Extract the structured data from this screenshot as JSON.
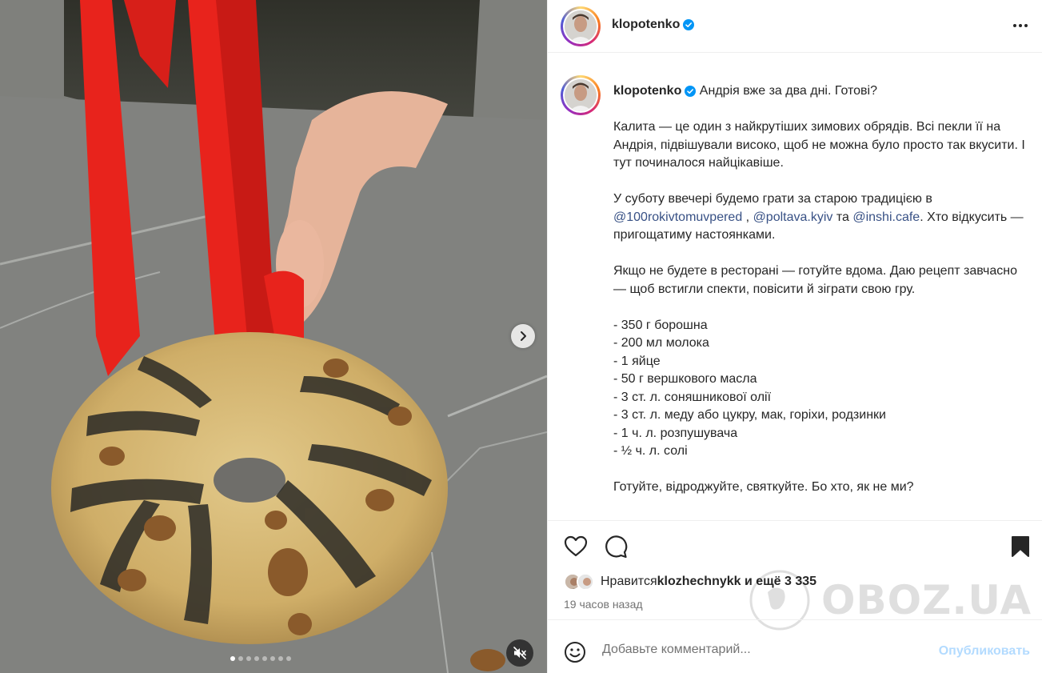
{
  "post": {
    "author": "klopotenko",
    "verified": true
  },
  "header": {
    "username": "klopotenko",
    "more_icon": "more-horizontal-icon"
  },
  "caption": {
    "username": "klopotenko",
    "first_line": " Андрія вже за два дні. Готові?",
    "para1": "Калита — це один з найкрутіших зимових обрядів. Всі пекли її на Андрія, підвішували високо, щоб не можна було просто так вкусити. І тут починалося найцікавіше.",
    "para2_start": "У суботу ввечері будемо грати за старою традицією в ",
    "mention1": "@100rokivtomuvpered",
    "sep1": " , ",
    "mention2": "@poltava.kyiv",
    "sep2": " та ",
    "mention3": "@inshi.cafe",
    "para2_end": ". Хто відкусить — пригощатиму настоянками.",
    "para3": "Якщо не будете в ресторані — готуйте вдома. Даю рецепт завчасно — щоб встигли спекти, повісити й зіграти свою гру.",
    "ingredients": [
      "- 350 г борошна",
      "- 200 мл молока",
      "- 1 яйце",
      "- 50 г вершкового масла",
      "- 3 ст. л. соняшникової олії",
      "- 3 ст. л. меду або цукру, мак, горіхи, родзинки",
      "- 1 ч. л. розпушувача",
      "- ½ ч. л. солі"
    ],
    "para4": "Готуйте, відроджуйте, святкуйте. Бо хто, як не ми?"
  },
  "actions": {
    "like_icon": "heart-icon",
    "comment_icon": "comment-icon",
    "save_icon": "bookmark-icon"
  },
  "likes": {
    "prefix": "Нравится ",
    "user": "klozhechnykk",
    "suffix": " и ещё 3 335"
  },
  "time_ago": "19 часов назад",
  "comment": {
    "placeholder": "Добавьте комментарий...",
    "publish_label": "Опубликовать",
    "emoji_icon": "emoji-icon"
  },
  "media": {
    "next_icon": "chevron-right-icon",
    "mute_icon": "speaker-muted-icon",
    "slide_count": 8,
    "active_slide": 1
  },
  "watermark": {
    "text": "OBOZ.UA"
  },
  "colors": {
    "link": "#385185",
    "verified": "#0095f6",
    "publish_disabled": "#b3dbff",
    "ribbon": "#e8231c"
  }
}
